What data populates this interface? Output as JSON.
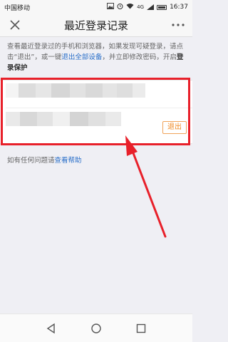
{
  "status_bar": {
    "carrier": "中国移动",
    "time": "16:37",
    "network": "4G",
    "icons": [
      "image-icon",
      "alarm-icon",
      "wifi-icon",
      "signal-icon",
      "battery-icon"
    ]
  },
  "nav": {
    "title": "最近登录记录",
    "close_icon": "close-icon",
    "more_icon": "more-icon"
  },
  "intro": {
    "line1": "查看最近登录过的手机和浏览器，如果发现可疑登录，",
    "text2_prefix": "请点击“退出”，或一键",
    "link_logout_all": "退出全部设备",
    "text2_suffix": "，并立即修改密码，",
    "text3_prefix": "开启",
    "bold_protection": "登录保护"
  },
  "record_card": {
    "logout_label": "退出"
  },
  "help": {
    "prefix": "如有任何问题请",
    "link": "查看帮助"
  },
  "annotation": {
    "highlight_color": "#e8202a",
    "arrow_color": "#e8202a"
  },
  "bottom_nav": {
    "icons": [
      "back-icon",
      "home-icon",
      "recent-apps-icon"
    ]
  },
  "colors": {
    "link": "#2a6fc9",
    "logout": "#f08a24",
    "background": "#efeff4"
  }
}
